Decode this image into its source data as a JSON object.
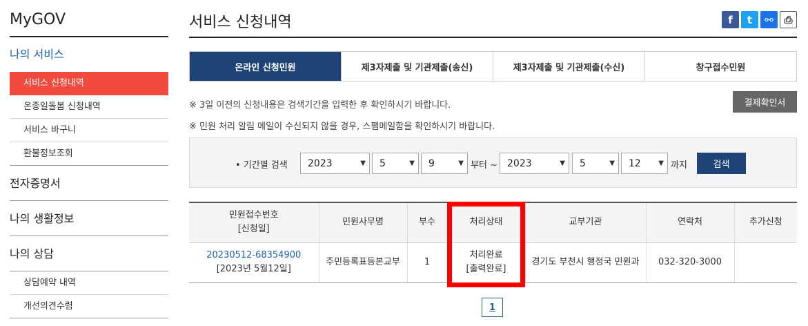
{
  "sidebar": {
    "title": "MyGOV",
    "my_services": "나의 서비스",
    "items": [
      {
        "label": "서비스 신청내역"
      },
      {
        "label": "온종일돌봄 신청내역"
      },
      {
        "label": "서비스 바구니"
      },
      {
        "label": "환불정보조회"
      }
    ],
    "sections": [
      {
        "label": "전자증명서"
      },
      {
        "label": "나의 생활정보"
      },
      {
        "label": "나의 상담"
      }
    ],
    "consult_items": [
      {
        "label": "상담예약 내역"
      },
      {
        "label": "개선의견수렴"
      }
    ]
  },
  "main": {
    "title": "서비스 신청내역",
    "share": {
      "facebook": "f",
      "twitter": "t",
      "link": "⚯",
      "print": "⎙"
    },
    "tabs": [
      {
        "label": "온라인 신청민원"
      },
      {
        "label": "제3자제출 및 기관제출(송신)"
      },
      {
        "label": "제3자제출 및 기관제출(수신)"
      },
      {
        "label": "창구접수민원"
      }
    ],
    "notice1": "※ 3일 이전의 신청내용은 검색기간을 입력한 후 확인하시기 바랍니다.",
    "notice2": "※ 민원 처리 알림 메일이 수신되지 않을 경우, 스팸메일함을 확인하시기 바랍니다.",
    "receipt_button": "결제확인서"
  },
  "search": {
    "label": "• 기간별 검색",
    "from_year": "2023",
    "from_month": "5",
    "from_day": "9",
    "from_text": "부터 ~",
    "to_year": "2023",
    "to_month": "5",
    "to_day": "12",
    "to_text": "까지",
    "button": "검색"
  },
  "table": {
    "headers": {
      "receipt_no": "민원접수번호",
      "receipt_date": "[신청일]",
      "name": "민원사무명",
      "copies": "부수",
      "status": "처리상태",
      "agency": "교부기관",
      "contact": "연락처",
      "extra": "추가신청"
    },
    "row": {
      "receipt_no": "20230512-68354900",
      "receipt_date": "[2023년 5월12일]",
      "name": "주민등록표등본교부",
      "copies": "1",
      "status": "처리완료",
      "status_sub": "[출력완료]",
      "agency": "경기도 부천시 행정국 민원과",
      "contact": "032-320-3000",
      "extra": ""
    }
  },
  "pagination": {
    "current": "1"
  },
  "colors": {
    "active_sidebar": "#f04b3c",
    "navy": "#1e4377",
    "highlight": "#ff0000"
  }
}
